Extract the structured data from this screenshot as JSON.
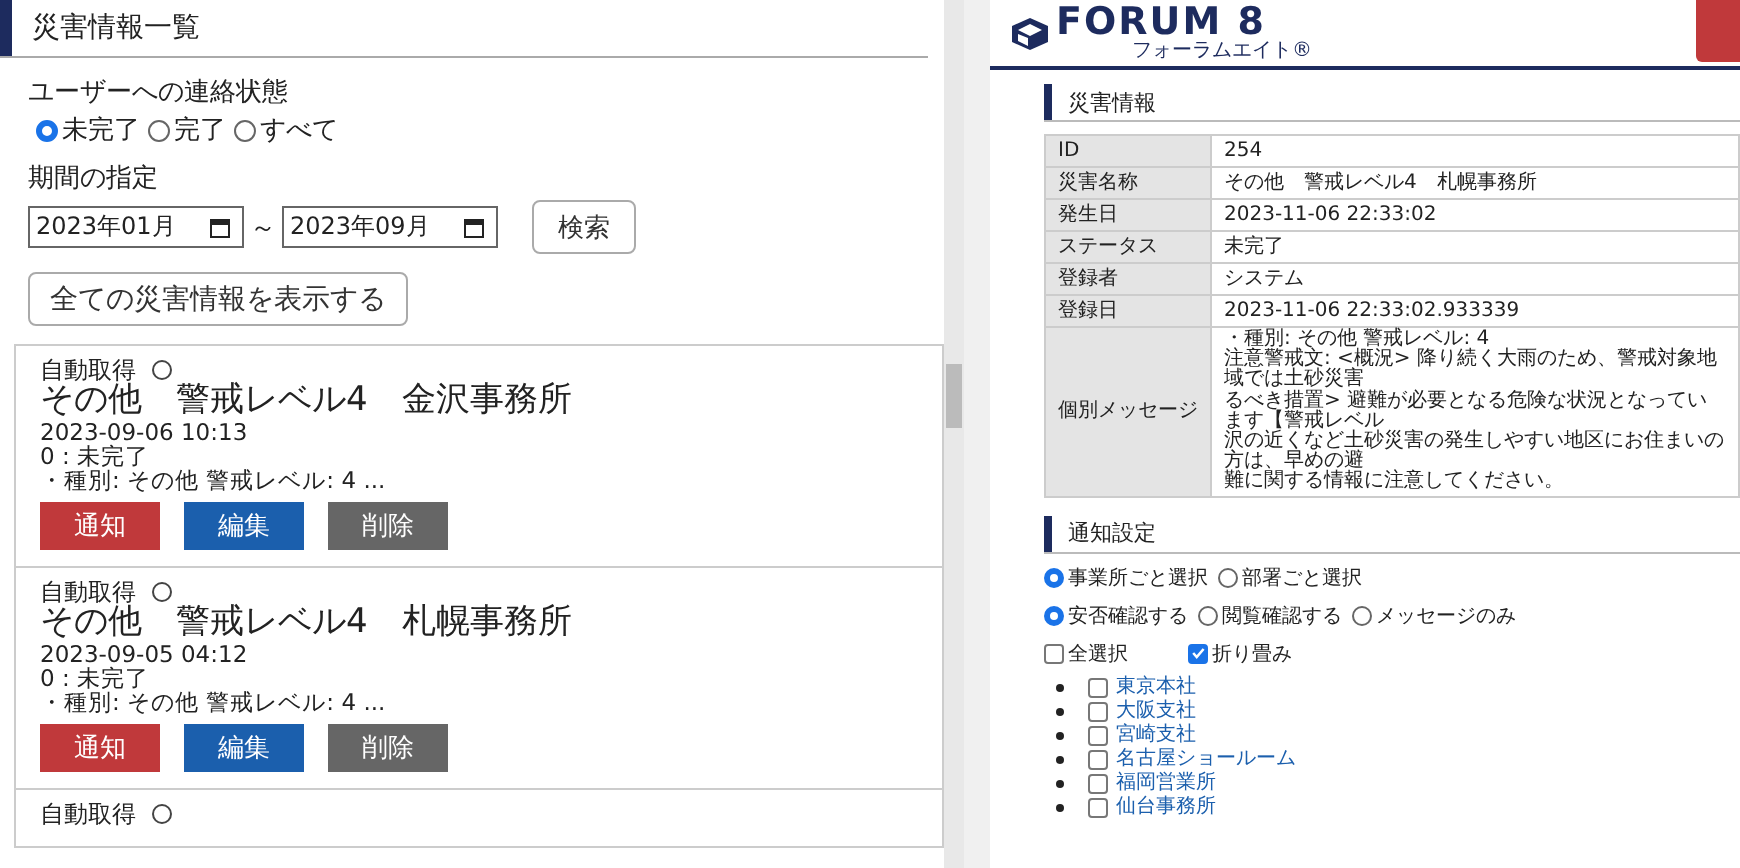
{
  "left": {
    "title": "災害情報一覧",
    "status_filter": {
      "label": "ユーザーへの連絡状態",
      "options": [
        {
          "label": "未完了",
          "selected": true
        },
        {
          "label": "完了",
          "selected": false
        },
        {
          "label": "すべて",
          "selected": false
        }
      ]
    },
    "period": {
      "label": "期間の指定",
      "from": "2023年01月",
      "separator": "～",
      "to": "2023年09月",
      "search_button": "検索"
    },
    "show_all_button": "全ての災害情報を表示する",
    "cards": [
      {
        "source": "自動取得",
        "title": "その他　警戒レベル4　金沢事務所",
        "datetime": "2023-09-06 10:13",
        "status": "0 : 未完了",
        "summary": "・種別: その他 警戒レベル: 4 ...",
        "buttons": [
          {
            "label": "通知",
            "kind": "notify"
          },
          {
            "label": "編集",
            "kind": "edit"
          },
          {
            "label": "削除",
            "kind": "delete"
          }
        ]
      },
      {
        "source": "自動取得",
        "title": "その他　警戒レベル4　札幌事務所",
        "datetime": "2023-09-05 04:12",
        "status": "0 : 未完了",
        "summary": "・種別: その他 警戒レベル: 4 ...",
        "buttons": [
          {
            "label": "通知",
            "kind": "notify"
          },
          {
            "label": "編集",
            "kind": "edit"
          },
          {
            "label": "削除",
            "kind": "delete"
          }
        ]
      },
      {
        "source": "自動取得"
      }
    ]
  },
  "right": {
    "logo": {
      "name": "FORUM 8",
      "sub": "フォーラムエイト®"
    },
    "info_title": "災害情報",
    "table": [
      {
        "label": "ID",
        "value": "254"
      },
      {
        "label": "災害名称",
        "value": "その他　警戒レベル4　札幌事務所"
      },
      {
        "label": "発生日",
        "value": "2023-11-06 22:33:02"
      },
      {
        "label": "ステータス",
        "value": "未完了"
      },
      {
        "label": "登録者",
        "value": "システム"
      },
      {
        "label": "登録日",
        "value": "2023-11-06 22:33:02.933339"
      }
    ],
    "message": {
      "label": "個別メッセージ",
      "lines": [
        "・種別: その他 警戒レベル: 4",
        "注意警戒文: <概況> 降り続く大雨のため、警戒対象地域では土砂災害",
        "るべき措置> 避難が必要となる危険な状況となっています【警戒レベル",
        "沢の近くなど土砂災害の発生しやすい地区にお住まいの方は、早めの避",
        "難に関する情報に注意してください。"
      ]
    },
    "notify_title": "通知設定",
    "radio_groups": [
      [
        {
          "label": "事業所ごと選択",
          "selected": true
        },
        {
          "label": "部署ごと選択",
          "selected": false
        }
      ],
      [
        {
          "label": "安否確認する",
          "selected": true
        },
        {
          "label": "閲覧確認する",
          "selected": false
        },
        {
          "label": "メッセージのみ",
          "selected": false
        }
      ]
    ],
    "checkboxes": [
      {
        "label": "全選択",
        "checked": false
      },
      {
        "label": "折り畳み",
        "checked": true
      }
    ],
    "offices": [
      {
        "label": "東京本社",
        "checked": false
      },
      {
        "label": "大阪支社",
        "checked": false
      },
      {
        "label": "宮崎支社",
        "checked": false
      },
      {
        "label": "名古屋ショールーム",
        "checked": false
      },
      {
        "label": "福岡営業所",
        "checked": false
      },
      {
        "label": "仙台事務所",
        "checked": false
      }
    ]
  }
}
